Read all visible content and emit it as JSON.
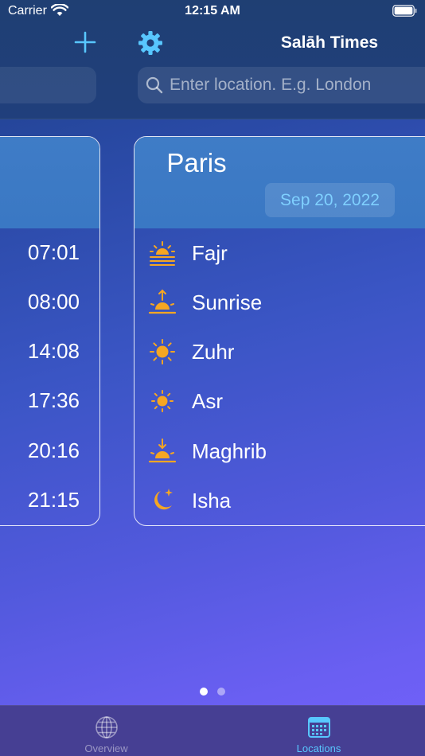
{
  "status_bar": {
    "carrier": "Carrier",
    "time": "12:15 AM"
  },
  "nav": {
    "title": "Salāh Times"
  },
  "search": {
    "placeholder": "Enter location. E.g. London"
  },
  "left_card": {
    "times": [
      "07:01",
      "08:00",
      "14:08",
      "17:36",
      "20:16",
      "21:15"
    ]
  },
  "right_card": {
    "city": "Paris",
    "date": "Sep 20, 2022",
    "prayers": [
      {
        "name": "Fajr",
        "icon": "fajr-icon"
      },
      {
        "name": "Sunrise",
        "icon": "sunrise-icon"
      },
      {
        "name": "Zuhr",
        "icon": "zuhr-sun-icon"
      },
      {
        "name": "Asr",
        "icon": "asr-sun-icon"
      },
      {
        "name": "Maghrib",
        "icon": "maghrib-sunset-icon"
      },
      {
        "name": "Isha",
        "icon": "isha-moon-icon"
      }
    ]
  },
  "pager": {
    "pages": 2,
    "active": 0
  },
  "tabs": [
    {
      "label": "Overview",
      "icon": "globe-icon",
      "selected": false
    },
    {
      "label": "Locations",
      "icon": "calendar-icon",
      "selected": true
    }
  ],
  "colors": {
    "accent": "#58c7ff",
    "icon_orange": "#f5a623",
    "date_text": "#7fd0ff"
  }
}
